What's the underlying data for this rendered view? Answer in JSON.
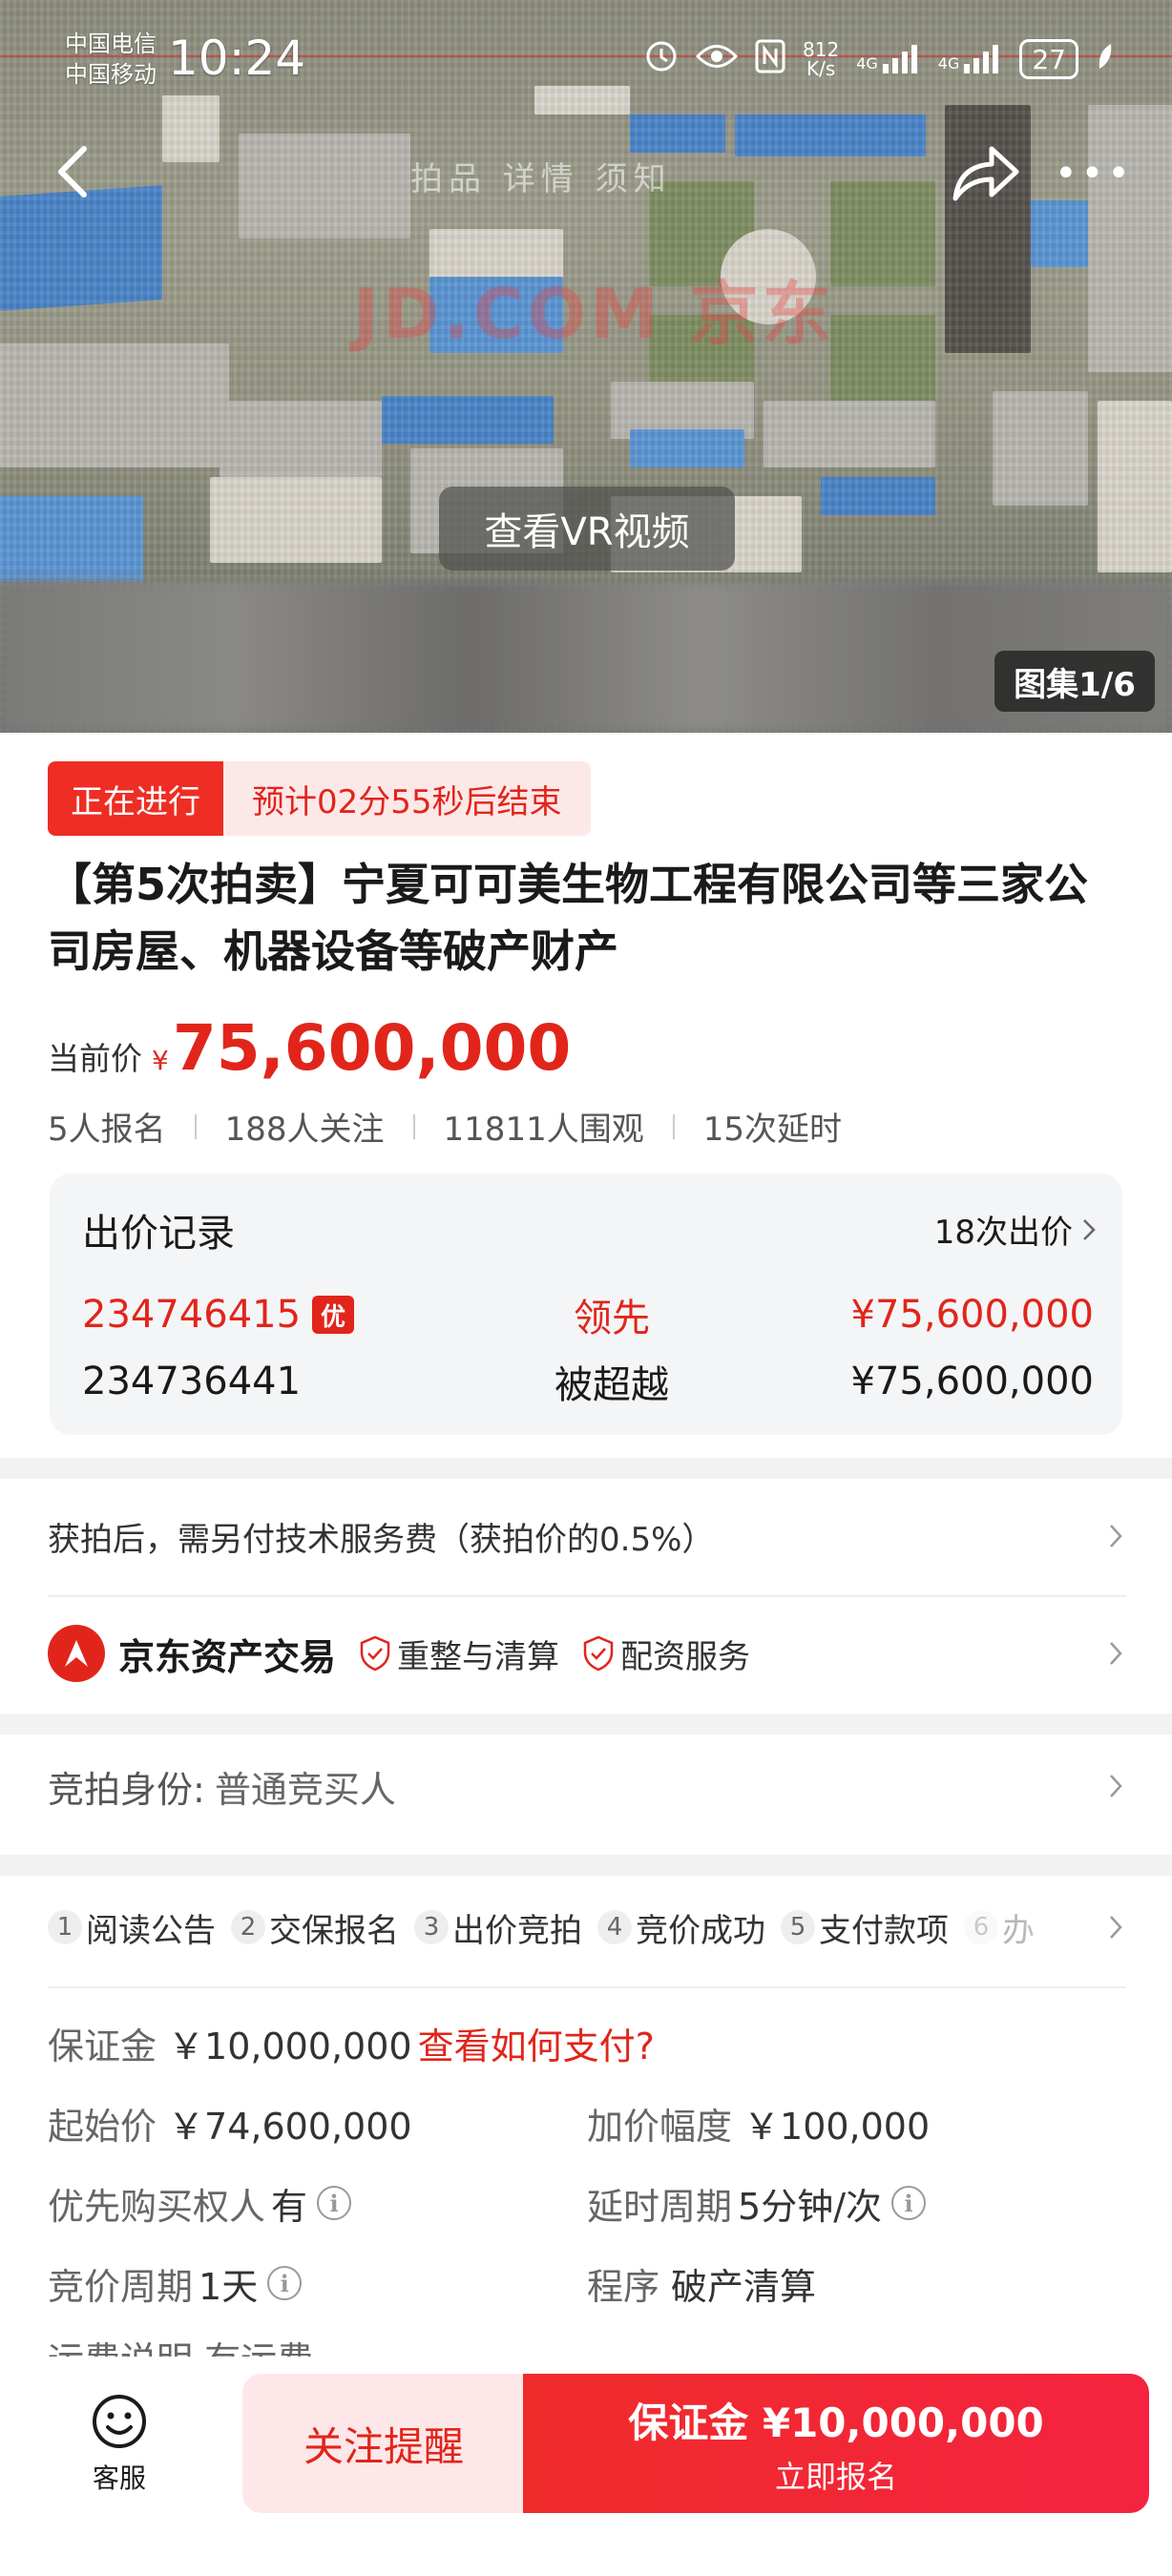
{
  "status_bar": {
    "carrier_1": "中国电信",
    "carrier_2": "中国移动",
    "time": "10:24",
    "net_speed_1": "812",
    "net_speed_2": "K/s",
    "net_type_1": "4G",
    "net_type_2": "4G",
    "battery": "27"
  },
  "header": {
    "tabs_faded": "拍品  详情  须知",
    "watermark": "JD.COM 京东"
  },
  "hero": {
    "vr_button": "查看VR视频",
    "gallery": "图集1/6"
  },
  "auction": {
    "status_tag": "正在进行",
    "countdown": "预计02分55秒后结束",
    "title": "【第5次拍卖】宁夏可可美生物工程有限公司等三家公司房屋、机器设备等破产财产",
    "price_label": "当前价",
    "currency": "¥",
    "current_price": "75,600,000",
    "stats": {
      "signups": "5人报名",
      "followers": "188人关注",
      "viewers": "11811人围观",
      "extensions": "15次延时"
    }
  },
  "bids": {
    "heading": "出价记录",
    "count": "18次出价",
    "rows": [
      {
        "bidder": "234746415",
        "badge": "优",
        "status": "领先",
        "price": "¥75,600,000"
      },
      {
        "bidder": "234736441",
        "status": "被超越",
        "price": "¥75,600,000"
      }
    ]
  },
  "fee_notice": "获拍后，需另付技术服务费（获拍价的0.5%）",
  "jd_service": {
    "name": "京东资产交易",
    "tag_1": "重整与清算",
    "tag_2": "配资服务"
  },
  "identity": {
    "label": "竞拍身份:",
    "value": "普通竞买人"
  },
  "steps": [
    {
      "num": "1",
      "label": "阅读公告"
    },
    {
      "num": "2",
      "label": "交保报名"
    },
    {
      "num": "3",
      "label": "出价竞拍"
    },
    {
      "num": "4",
      "label": "竞价成功"
    },
    {
      "num": "5",
      "label": "支付款项"
    },
    {
      "num": "6",
      "label": "办"
    }
  ],
  "details": {
    "deposit_label": "保证金",
    "deposit_value": "￥10,000,000",
    "deposit_link": "查看如何支付?",
    "start_label": "起始价",
    "start_value": "￥74,600,000",
    "increment_label": "加价幅度",
    "increment_value": "￥100,000",
    "priority_label": "优先购买权人",
    "priority_value": "有",
    "delay_label": "延时周期",
    "delay_value": "5分钟/次",
    "period_label": "竞价周期",
    "period_value": "1天",
    "procedure_label": "程序",
    "procedure_value": "破产清算",
    "shipping_cut": "运费说明  有运费"
  },
  "bottom_bar": {
    "service_label": "客服",
    "follow_label": "关注提醒",
    "deposit_button": "保证金 ¥10,000,000",
    "signup_label": "立即报名"
  }
}
